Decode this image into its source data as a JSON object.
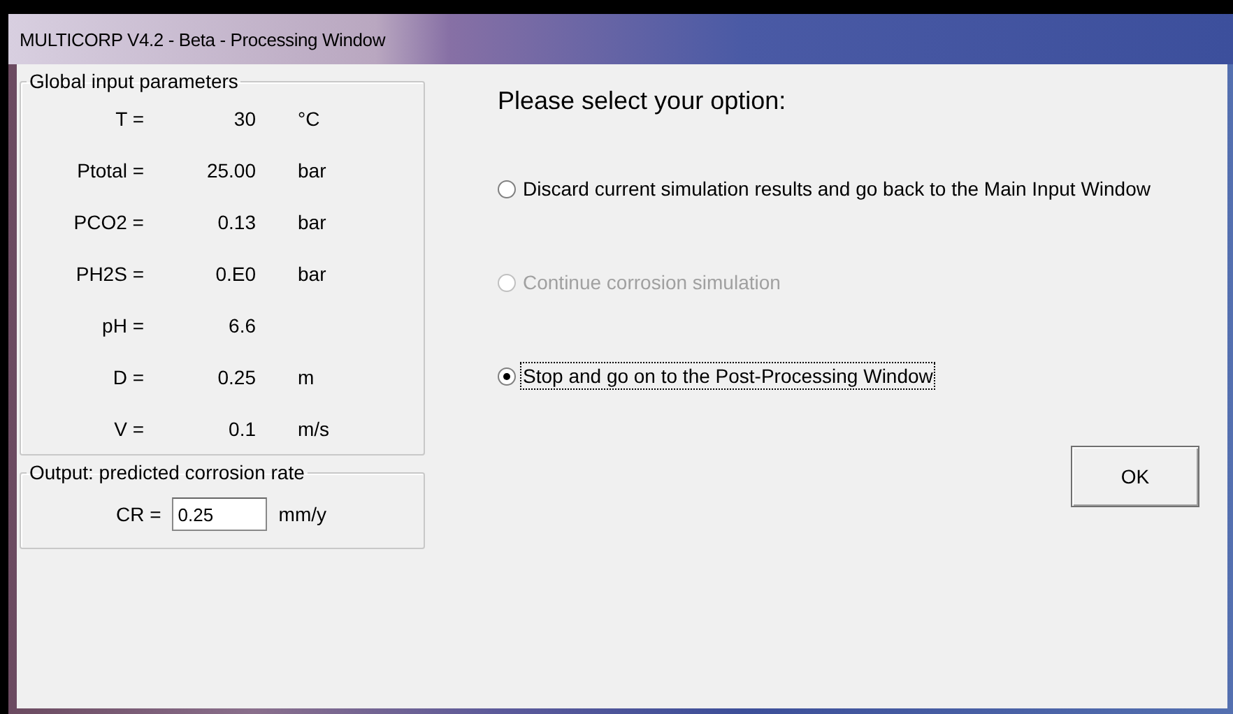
{
  "window": {
    "title": "MULTICORP V4.2 - Beta - Processing Window"
  },
  "input_group": {
    "title": "Global input parameters",
    "rows": [
      {
        "label": "T =",
        "value": "30",
        "unit": "°C"
      },
      {
        "label": "Ptotal =",
        "value": "25.00",
        "unit": "bar"
      },
      {
        "label": "PCO2 =",
        "value": "0.13",
        "unit": "bar"
      },
      {
        "label": "PH2S =",
        "value": "0.E0",
        "unit": "bar"
      },
      {
        "label": "pH =",
        "value": "6.6"
      },
      {
        "label": "D =",
        "value": "0.25",
        "unit": "m"
      },
      {
        "label": "V =",
        "value": "0.1",
        "unit": "m/s"
      }
    ]
  },
  "output_group": {
    "title": "Output: predicted corrosion rate",
    "label": "CR =",
    "value": "0.25",
    "unit": "mm/y"
  },
  "heading": "Please select your option:",
  "options": [
    {
      "label": "Discard current simulation results and go back to the Main Input Window",
      "selected": false,
      "disabled": false,
      "focused": false
    },
    {
      "label": "Continue corrosion simulation",
      "selected": false,
      "disabled": true,
      "focused": false
    },
    {
      "label": "Stop and go on to the Post-Processing Window",
      "selected": true,
      "disabled": false,
      "focused": true
    }
  ],
  "buttons": [
    "OK"
  ]
}
